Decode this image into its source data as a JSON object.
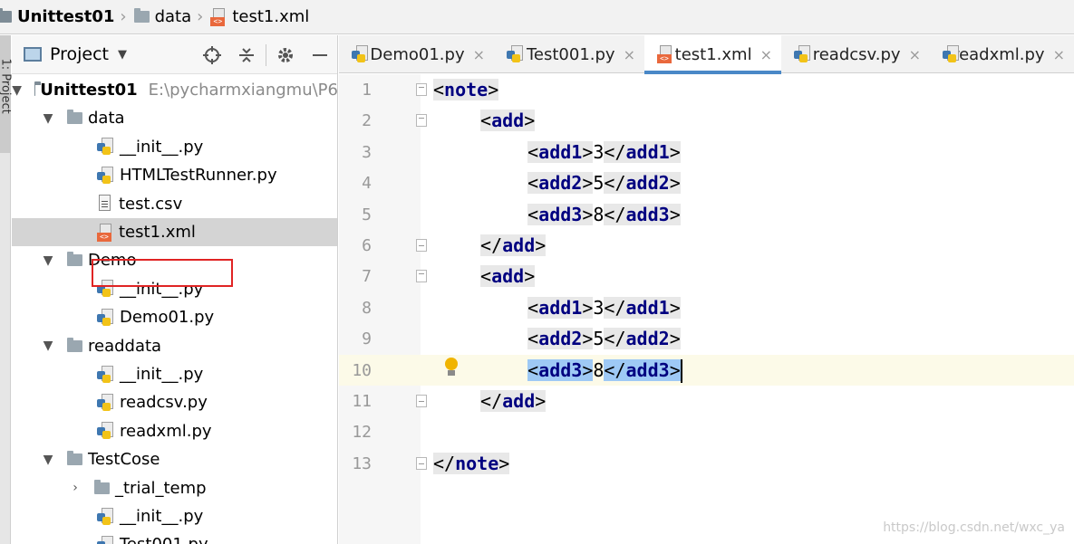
{
  "breadcrumb": {
    "project": "Unittest01",
    "folder": "data",
    "file": "test1.xml"
  },
  "stripe": {
    "label": "1: Project"
  },
  "panel": {
    "title": "Project",
    "caret": "▼",
    "icons": [
      "crosshair-icon",
      "collapse-icon",
      "gear-icon",
      "minimize-icon"
    ]
  },
  "tree": [
    {
      "label": "Unittest01",
      "path": "E:\\pycharmxiangmu\\P6",
      "arrow": "▼",
      "type": "folder",
      "bold": true
    },
    {
      "label": "data",
      "arrow": "▼",
      "type": "folder"
    },
    {
      "label": "__init__.py",
      "type": "py"
    },
    {
      "label": "HTMLTestRunner.py",
      "type": "py"
    },
    {
      "label": "test.csv",
      "type": "csv"
    },
    {
      "label": "test1.xml",
      "type": "xml",
      "selected": true
    },
    {
      "label": "Demo",
      "arrow": "▼",
      "type": "folder"
    },
    {
      "label": "__init__.py",
      "type": "py"
    },
    {
      "label": "Demo01.py",
      "type": "py"
    },
    {
      "label": "readdata",
      "arrow": "▼",
      "type": "folder"
    },
    {
      "label": "__init__.py",
      "type": "py"
    },
    {
      "label": "readcsv.py",
      "type": "py"
    },
    {
      "label": "readxml.py",
      "type": "py"
    },
    {
      "label": "TestCose",
      "arrow": "▼",
      "type": "folder"
    },
    {
      "label": "_trial_temp",
      "arrow": "›",
      "type": "folder"
    },
    {
      "label": "__init__.py",
      "type": "py"
    },
    {
      "label": "Test001.py",
      "type": "py"
    }
  ],
  "tabs": [
    {
      "label": "Demo01.py",
      "type": "py"
    },
    {
      "label": "Test001.py",
      "type": "py"
    },
    {
      "label": "test1.xml",
      "type": "xml",
      "active": true
    },
    {
      "label": "readcsv.py",
      "type": "py"
    },
    {
      "label": "readxml.py",
      "type": "py"
    }
  ],
  "tab_close": "×",
  "code": {
    "line_numbers": [
      "1",
      "2",
      "3",
      "4",
      "5",
      "6",
      "7",
      "8",
      "9",
      "10",
      "11",
      "12",
      "13"
    ],
    "current_line": "10",
    "lines": [
      {
        "open": "note"
      },
      {
        "open": "add"
      },
      {
        "elem": "add1",
        "value": "3"
      },
      {
        "elem": "add2",
        "value": "5"
      },
      {
        "elem": "add3",
        "value": "8"
      },
      {
        "close": "add"
      },
      {
        "open": "add"
      },
      {
        "elem": "add1",
        "value": "3"
      },
      {
        "elem": "add2",
        "value": "5"
      },
      {
        "elem": "add3",
        "value": "8",
        "selected": true
      },
      {
        "close": "add"
      },
      {},
      {
        "close": "note"
      }
    ]
  },
  "watermark": "https://blog.csdn.net/wxc_ya"
}
